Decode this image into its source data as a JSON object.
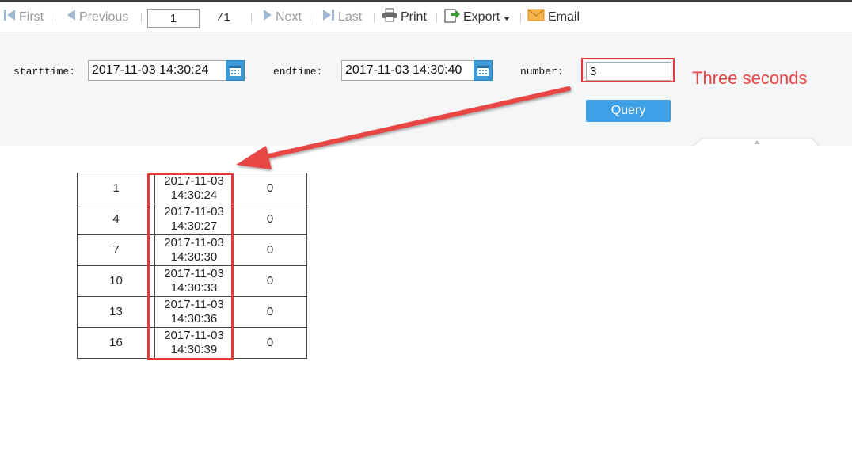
{
  "toolbar": {
    "first_label": "First",
    "previous_label": "Previous",
    "page_value": "1",
    "page_total": "/1",
    "next_label": "Next",
    "last_label": "Last",
    "print_label": "Print",
    "export_label": "Export",
    "email_label": "Email"
  },
  "filters": {
    "starttime_label": "starttime:",
    "starttime_value": "2017-11-03 14:30:24",
    "endtime_label": "endtime:",
    "endtime_value": "2017-11-03 14:30:40",
    "number_label": "number:",
    "number_value": "3",
    "query_label": "Query"
  },
  "annotation": {
    "text": "Three seconds",
    "color": "#e84545"
  },
  "table": {
    "rows": [
      [
        "1",
        "2017-11-03",
        "14:30:24",
        "0"
      ],
      [
        "4",
        "2017-11-03",
        "14:30:27",
        "0"
      ],
      [
        "7",
        "2017-11-03",
        "14:30:30",
        "0"
      ],
      [
        "10",
        "2017-11-03",
        "14:30:33",
        "0"
      ],
      [
        "13",
        "2017-11-03",
        "14:30:36",
        "0"
      ],
      [
        "16",
        "2017-11-03",
        "14:30:39",
        "0"
      ]
    ]
  },
  "colors": {
    "query_button": "#3ea1e8",
    "calendar_button": "#3d9ad6",
    "highlight": "#e33b3b"
  }
}
